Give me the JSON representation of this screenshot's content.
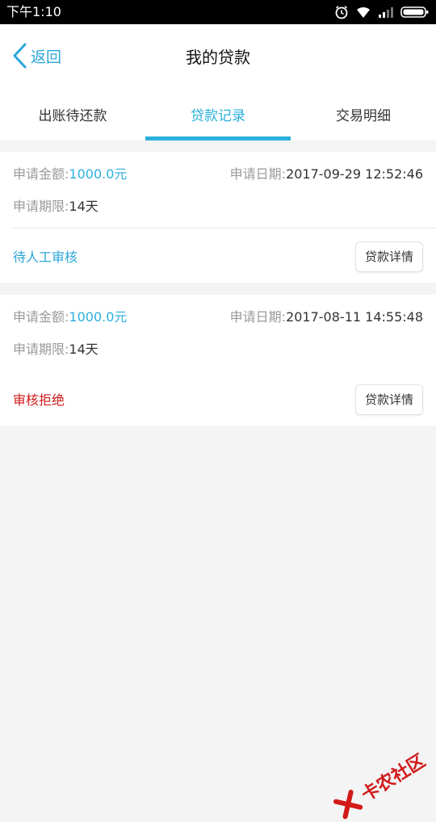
{
  "status_bar": {
    "time": "下午1:10"
  },
  "header": {
    "back_label": "返回",
    "title": "我的贷款"
  },
  "tabs": [
    {
      "label": "出账待还款",
      "active": false
    },
    {
      "label": "贷款记录",
      "active": true
    },
    {
      "label": "交易明细",
      "active": false
    }
  ],
  "records": [
    {
      "amount_label": "申请金额:",
      "amount": "1000.0元",
      "date_label": "申请日期:",
      "date": "2017-09-29 12:52:46",
      "term_label": "申请期限:",
      "term": "14天",
      "status": "待人工审核",
      "status_color": "#2ba6d9",
      "detail_button": "贷款详情"
    },
    {
      "amount_label": "申请金额:",
      "amount": "1000.0元",
      "date_label": "申请日期:",
      "date": "2017-08-11 14:55:48",
      "term_label": "申请期限:",
      "term": "14天",
      "status": "审核拒绝",
      "status_color": "#d11a1a",
      "detail_button": "贷款详情"
    }
  ],
  "watermark": {
    "text": "卡农社区"
  },
  "colors": {
    "accent": "#2bb0dc",
    "rejected": "#d11a1a"
  }
}
